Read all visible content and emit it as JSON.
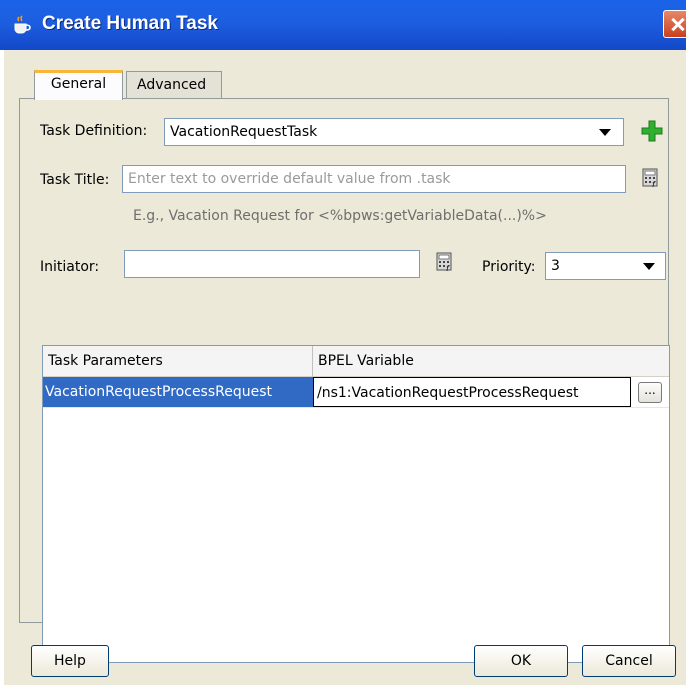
{
  "window": {
    "title": "Create Human Task"
  },
  "tabs": [
    {
      "label": "General",
      "selected": true
    },
    {
      "label": "Advanced",
      "selected": false
    }
  ],
  "form": {
    "task_definition": {
      "label": "Task Definition:",
      "mnemonic": "T",
      "value": "VacationRequestTask"
    },
    "task_title": {
      "label": "Task Title:",
      "mnemonic": "a",
      "value": "",
      "placeholder": "Enter text to override default value from .task",
      "hint": "E.g., Vacation Request for <%bpws:getVariableData(...)%>"
    },
    "initiator": {
      "label": "Initiator:",
      "mnemonic": "I",
      "value": ""
    },
    "priority": {
      "label": "Priority:",
      "mnemonic": "P",
      "value": "3"
    }
  },
  "parameters_table": {
    "columns": [
      "Task Parameters",
      "BPEL Variable"
    ],
    "rows": [
      {
        "parameter": "VacationRequestProcessRequest",
        "variable": "/ns1:VacationRequestProcessRequest",
        "button": "..."
      }
    ]
  },
  "buttons": {
    "help": "Help",
    "ok": "OK",
    "cancel": "Cancel"
  },
  "colors": {
    "titlebar": "#1d5ee0",
    "selection": "#316ac5",
    "dialog_bg": "#ece9d8",
    "add_icon": "#2fb02f"
  },
  "icons": {
    "app": "coffee-cup-icon",
    "add": "plus-icon",
    "expression": "expression-builder-icon",
    "close": "close-icon"
  }
}
